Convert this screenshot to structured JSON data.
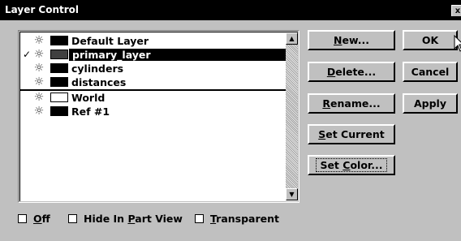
{
  "window": {
    "title": "Layer Control",
    "close_label": "x"
  },
  "layers": [
    {
      "check": "",
      "name": "Default Layer",
      "color": "#000000",
      "selected": false
    },
    {
      "check": "✓",
      "name": "primary_layer",
      "color": "#404040",
      "selected": true
    },
    {
      "check": "",
      "name": "cylinders",
      "color": "#000000",
      "selected": false
    },
    {
      "check": "",
      "name": "distances",
      "color": "#000000",
      "selected": false
    },
    {
      "check": "",
      "name": "World",
      "color": "#ffffff",
      "selected": false
    },
    {
      "check": "",
      "name": "Ref #1",
      "color": "#000000",
      "selected": false
    }
  ],
  "buttons": {
    "new": {
      "accel": "N",
      "rest": "ew..."
    },
    "delete": {
      "accel": "D",
      "rest": "elete..."
    },
    "rename": {
      "accel": "R",
      "rest": "ename..."
    },
    "set_current": {
      "pre": "",
      "accel": "S",
      "rest": "et Current"
    },
    "set_color": {
      "pre": "Set ",
      "accel": "C",
      "rest": "olor..."
    },
    "ok": "OK",
    "cancel": "Cancel",
    "apply": "Apply"
  },
  "checkboxes": {
    "off": {
      "accel": "O",
      "rest": "ff"
    },
    "hide": {
      "pre": "Hide In ",
      "accel": "P",
      "rest": "art View"
    },
    "transparent": {
      "accel": "T",
      "rest": "ransparent"
    }
  }
}
